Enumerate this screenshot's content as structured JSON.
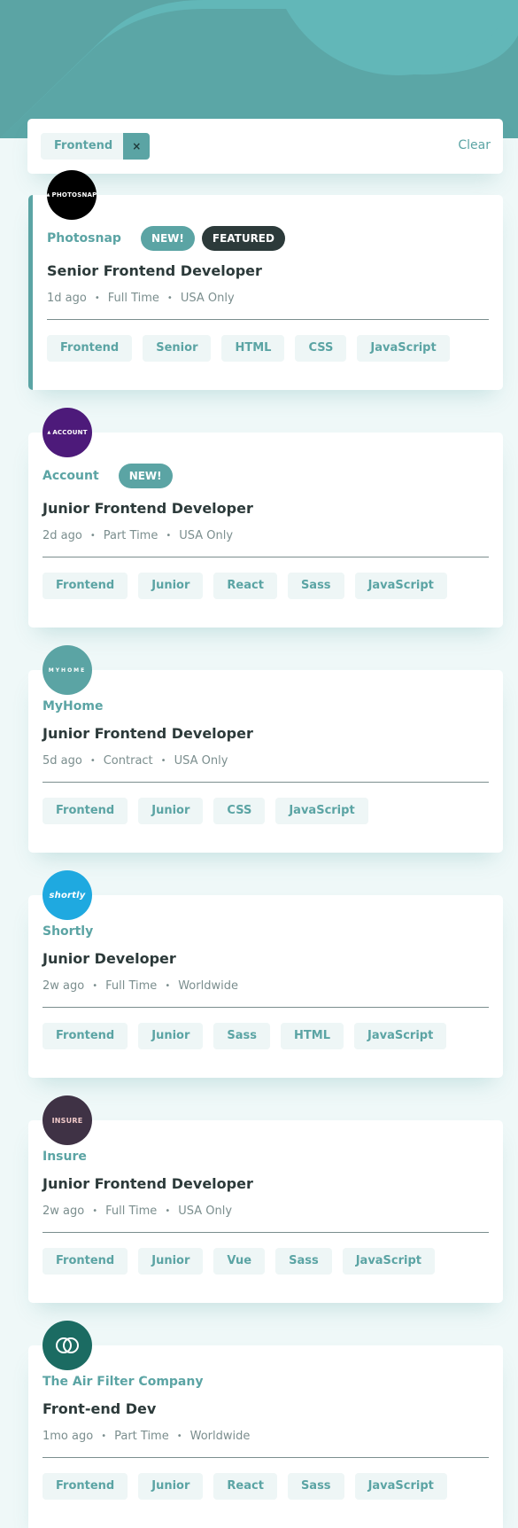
{
  "filter": {
    "chips": [
      "Frontend"
    ],
    "remove_symbol": "×",
    "clear_label": "Clear"
  },
  "jobs": [
    {
      "company": "Photosnap",
      "logo_text": "PHOTOSNAP",
      "logo_color": "#000000",
      "new_label": "NEW!",
      "featured_label": "FEATURED",
      "position": "Senior Frontend Developer",
      "posted": "1d ago",
      "contract": "Full Time",
      "location": "USA Only",
      "tags": [
        "Frontend",
        "Senior",
        "HTML",
        "CSS",
        "JavaScript"
      ]
    },
    {
      "company": "Account",
      "logo_text": "ACCOUNT",
      "logo_color": "#4d1a7a",
      "new_label": "NEW!",
      "position": "Junior Frontend Developer",
      "posted": "2d ago",
      "contract": "Part Time",
      "location": "USA Only",
      "tags": [
        "Frontend",
        "Junior",
        "React",
        "Sass",
        "JavaScript"
      ]
    },
    {
      "company": "MyHome",
      "logo_text": "MYHOME",
      "logo_color": "#5ba4a4",
      "position": "Junior Frontend Developer",
      "posted": "5d ago",
      "contract": "Contract",
      "location": "USA Only",
      "tags": [
        "Frontend",
        "Junior",
        "CSS",
        "JavaScript"
      ]
    },
    {
      "company": "Shortly",
      "logo_text": "shortly",
      "logo_color": "#1fa9e0",
      "position": "Junior Developer",
      "posted": "2w ago",
      "contract": "Full Time",
      "location": "Worldwide",
      "tags": [
        "Frontend",
        "Junior",
        "Sass",
        "HTML",
        "JavaScript"
      ]
    },
    {
      "company": "Insure",
      "logo_text": "INSURE",
      "logo_color": "#3f3245",
      "position": "Junior Frontend Developer",
      "posted": "2w ago",
      "contract": "Full Time",
      "location": "USA Only",
      "tags": [
        "Frontend",
        "Junior",
        "Vue",
        "Sass",
        "JavaScript"
      ]
    },
    {
      "company": "The Air Filter Company",
      "logo_color": "#1b6b62",
      "position": "Front-end Dev",
      "posted": "1mo ago",
      "contract": "Part Time",
      "location": "Worldwide",
      "tags": [
        "Frontend",
        "Junior",
        "React",
        "Sass",
        "JavaScript"
      ]
    }
  ]
}
